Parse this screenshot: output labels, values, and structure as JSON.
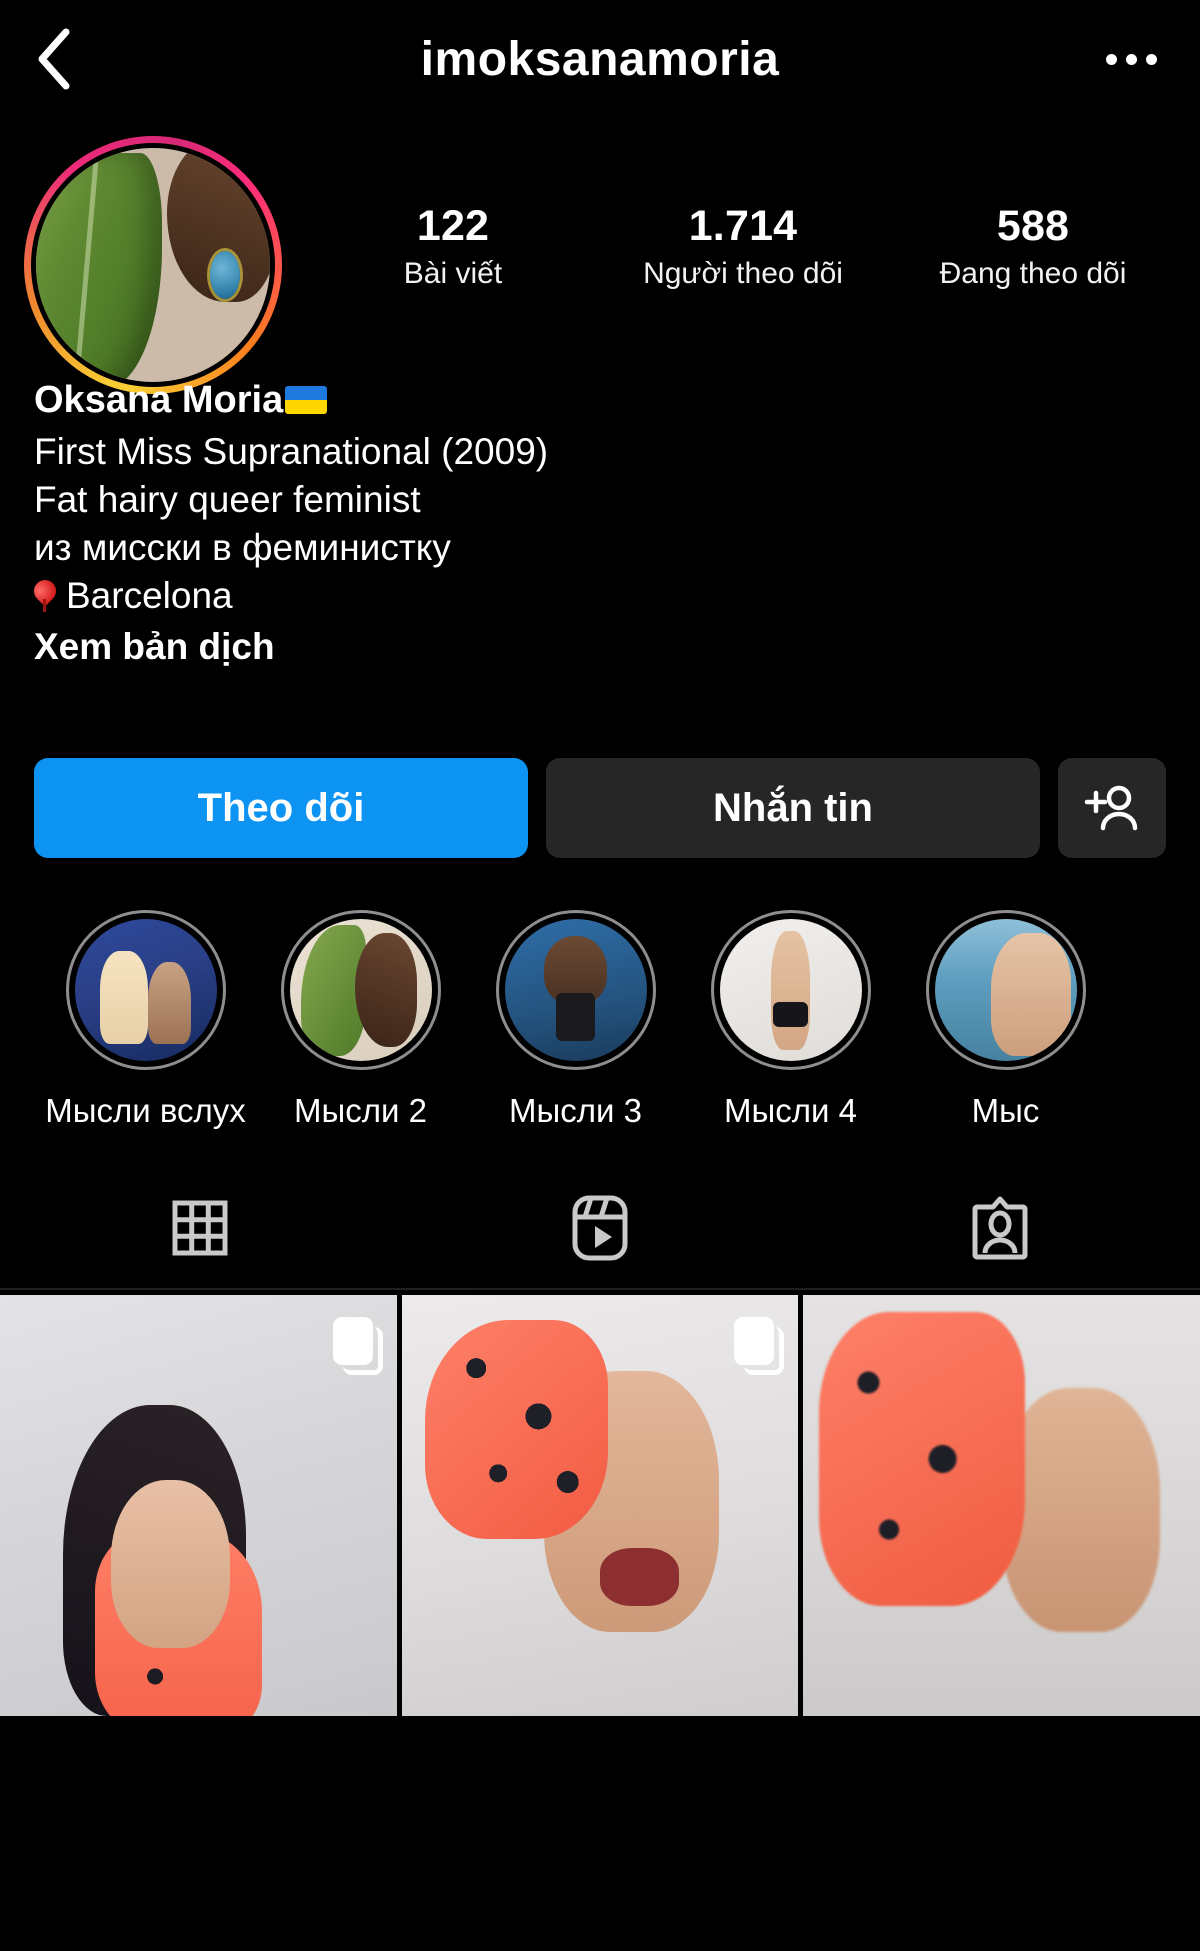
{
  "header": {
    "title": "imoksanamoria",
    "back_icon": "chevron-left-icon",
    "menu_icon": "more-options-icon"
  },
  "profile": {
    "avatar_alt": "profile-photo",
    "has_story_ring": true,
    "stats": [
      {
        "value": "122",
        "label": "Bài viết",
        "name": "posts"
      },
      {
        "value": "1.714",
        "label": "Người theo dõi",
        "name": "followers"
      },
      {
        "value": "588",
        "label": "Đang theo dõi",
        "name": "following"
      }
    ],
    "display_name": "Oksana Moria",
    "name_flag": "ukraine-flag-emoji",
    "bio_lines": [
      "First Miss Supranational (2009)",
      "Fat hairy queer feminist",
      "из мисски в феминистку"
    ],
    "location": "Barcelona",
    "location_icon": "location-pin-icon",
    "translate_label": "Xem bản dịch"
  },
  "actions": {
    "follow_label": "Theo dõi",
    "message_label": "Nhắn tin",
    "add_user_icon": "add-person-icon",
    "follow_color": "#0d93f2",
    "secondary_color": "#262626"
  },
  "highlights": [
    {
      "label": "Мысли вслух",
      "thumb": "thumb-pageant"
    },
    {
      "label": "Мысли 2",
      "thumb": "thumb-leaf"
    },
    {
      "label": "Мысли 3",
      "thumb": "thumb-mirror"
    },
    {
      "label": "Мысли 4",
      "thumb": "thumb-bikini"
    },
    {
      "label": "Мыс",
      "thumb": "thumb-sea"
    }
  ],
  "tabs": [
    {
      "name": "grid-tab",
      "icon": "grid-icon",
      "active": true
    },
    {
      "name": "reels-tab",
      "icon": "reels-icon",
      "active": false
    },
    {
      "name": "tagged-tab",
      "icon": "tagged-person-icon",
      "active": false
    }
  ],
  "posts": [
    {
      "name": "post-1",
      "is_carousel": true
    },
    {
      "name": "post-2",
      "is_carousel": true
    },
    {
      "name": "post-3",
      "is_carousel": false
    }
  ]
}
